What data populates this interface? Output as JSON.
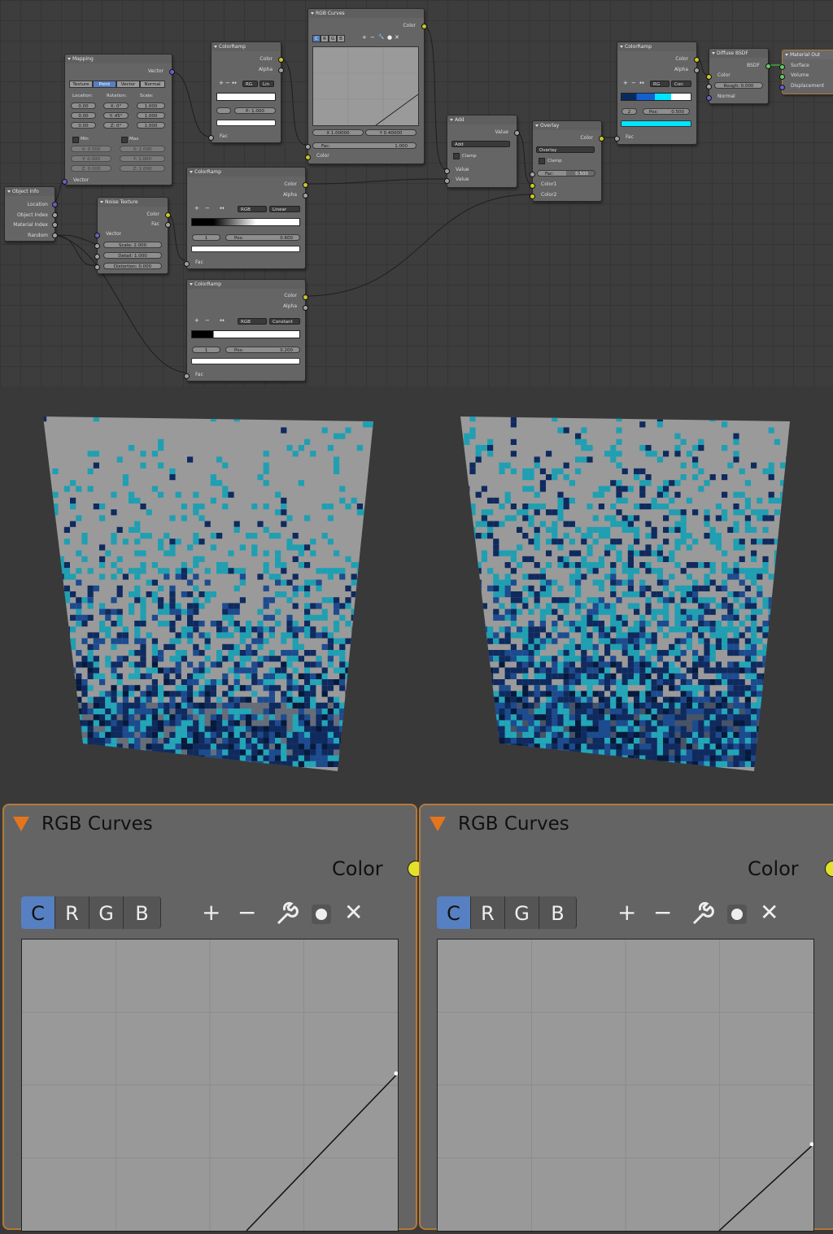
{
  "nodes": {
    "mapping": {
      "title": "Mapping",
      "out_vector": "Vector",
      "tabs": [
        "Texture",
        "Point",
        "Vector",
        "Normal"
      ],
      "active_tab": "Point",
      "col_labels": [
        "Location:",
        "Rotation:",
        "Scale:"
      ],
      "location": [
        "0.00",
        "0.00",
        "0.00"
      ],
      "rotation": [
        "X: 0°",
        "Y: 45°",
        "Z: 0°"
      ],
      "scale": [
        "1.000",
        "1.000",
        "1.000"
      ],
      "min_label": "Min",
      "max_label": "Max",
      "min_values": [
        "X: 0.000",
        "Y: 0.000",
        "Z: 0.000"
      ],
      "max_values": [
        "X: 1.000",
        "Y: 1.000",
        "Z: 1.000"
      ],
      "in_vector": "Vector"
    },
    "object_info": {
      "title": "Object Info",
      "outputs": [
        "Location",
        "Object Index",
        "Material Index",
        "Random"
      ]
    },
    "noise_texture": {
      "title": "Noise Texture",
      "outputs": [
        "Color",
        "Fac"
      ],
      "in_vector": "Vector",
      "scale": "Scale:     2.000",
      "detail": "Detail:    1.000",
      "distortion": "Distortion: 0.000"
    },
    "colorramp_top": {
      "title": "ColorRamp",
      "outputs": [
        "Color",
        "Alpha"
      ],
      "mode": "RG",
      "interp": "Lin",
      "index": "",
      "pos": "P: 1.000",
      "in_fac": "Fac"
    },
    "rgb_curves_small": {
      "title": "RGB Curves",
      "out_color": "Color",
      "channels": [
        "C",
        "R",
        "G",
        "B"
      ],
      "x_value": "X 1.00000",
      "y_value": "Y 0.40000",
      "fac": "Fac:",
      "fac_value": "1.000",
      "in_color": "Color"
    },
    "colorramp_mid": {
      "title": "ColorRamp",
      "outputs": [
        "Color",
        "Alpha"
      ],
      "mode": "RGB",
      "interp": "Linear",
      "index": "1",
      "pos": "Pos:",
      "pos_value": "0.600",
      "in_fac": "Fac"
    },
    "colorramp_low": {
      "title": "ColorRamp",
      "outputs": [
        "Color",
        "Alpha"
      ],
      "mode": "RGB",
      "interp": "Constant",
      "index": "1",
      "pos": "Pos:",
      "pos_value": "0.200",
      "in_fac": "Fac"
    },
    "add": {
      "title": "Add",
      "out_value": "Value",
      "op": "Add",
      "clamp": "Clamp",
      "inputs": [
        "Value",
        "Value"
      ]
    },
    "overlay": {
      "title": "Overlay",
      "out_color": "Color",
      "op": "Overlay",
      "clamp": "Clamp",
      "fac": "Fac:",
      "fac_value": "0.500",
      "inputs": [
        "Color1",
        "Color2"
      ]
    },
    "colorramp_right": {
      "title": "ColorRamp",
      "outputs": [
        "Color",
        "Alpha"
      ],
      "mode": "RG",
      "interp": "Con",
      "index": "2",
      "pos": "Pos:",
      "pos_value": "0.500",
      "in_fac": "Fac",
      "swatch_color": "#00e5ff"
    },
    "diffuse": {
      "title": "Diffuse BSDF",
      "out_bsdf": "BSDF",
      "in_color": "Color",
      "rough": "Rough: 0.000",
      "in_normal": "Normal"
    },
    "material_output": {
      "title": "Material Out",
      "inputs": [
        "Surface",
        "Volume",
        "Displacement"
      ]
    }
  },
  "big_curves": [
    {
      "title": "RGB Curves",
      "out_color": "Color",
      "channels": [
        "C",
        "R",
        "G",
        "B"
      ],
      "active_channel": "C",
      "curve_end_y": 0.4
    },
    {
      "title": "RGB Curves",
      "out_color": "Color",
      "channels": [
        "C",
        "R",
        "G",
        "B"
      ],
      "active_channel": "C",
      "curve_end_y": 0.22
    }
  ],
  "colors": {
    "accent": "#5680c2",
    "header_triangle": "#e5751d",
    "socket_color": "#c7c729",
    "socket_value": "#a1a1a1",
    "socket_vector": "#6363c7",
    "socket_shader": "#63c763",
    "plane_base": "#9a9a9a",
    "teal": "#1f9fb2",
    "navy": "#0f2a5e",
    "deep": "#061a3c"
  },
  "icons": [
    "plus-icon",
    "minus-icon",
    "wrench-icon",
    "circle-icon",
    "x-icon",
    "collapse-triangle-icon"
  ]
}
